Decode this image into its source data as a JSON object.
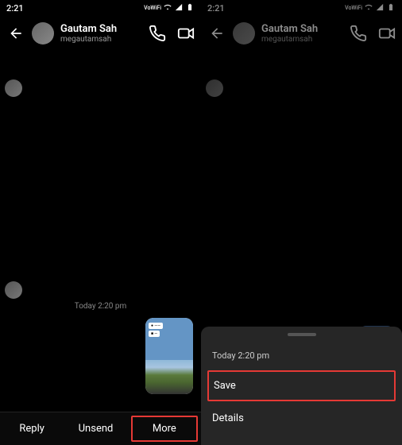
{
  "status": {
    "time": "2:21",
    "vowifi": "VoWiFi"
  },
  "header": {
    "name": "Gautam Sah",
    "handle": "megautamsah"
  },
  "chat": {
    "timestamp": "Today 2:20 pm"
  },
  "bottom": {
    "reply": "Reply",
    "unsend": "Unsend",
    "more": "More"
  },
  "sheet": {
    "time": "Today 2:20 pm",
    "save": "Save",
    "details": "Details"
  }
}
